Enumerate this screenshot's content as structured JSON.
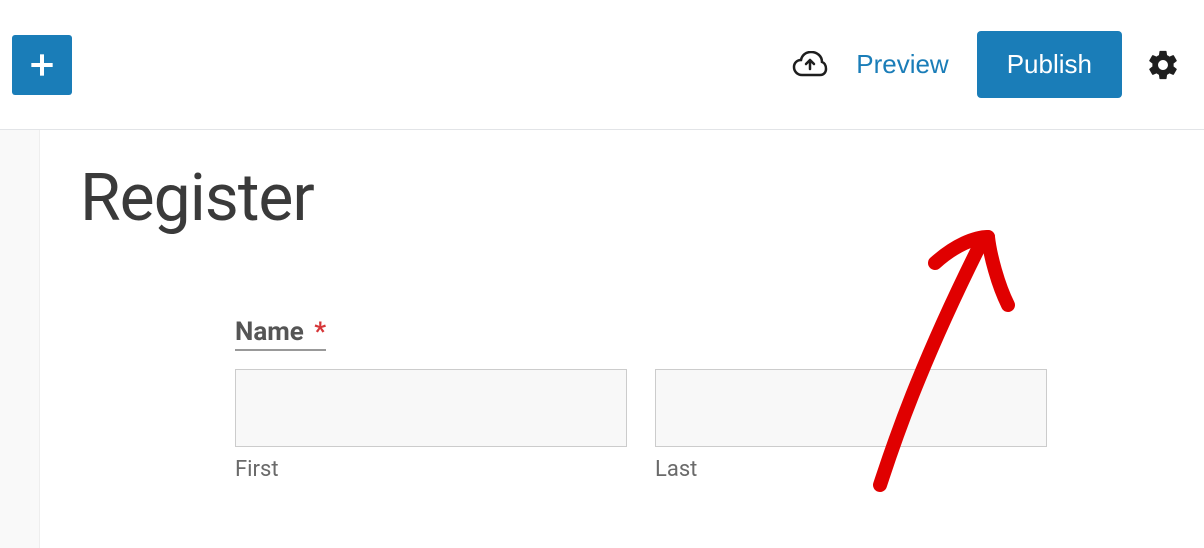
{
  "toolbar": {
    "preview_label": "Preview",
    "publish_label": "Publish"
  },
  "page": {
    "title": "Register"
  },
  "form": {
    "name_label": "Name",
    "required_marker": "*",
    "first_sub_label": "First",
    "last_sub_label": "Last",
    "first_value": "",
    "last_value": ""
  }
}
